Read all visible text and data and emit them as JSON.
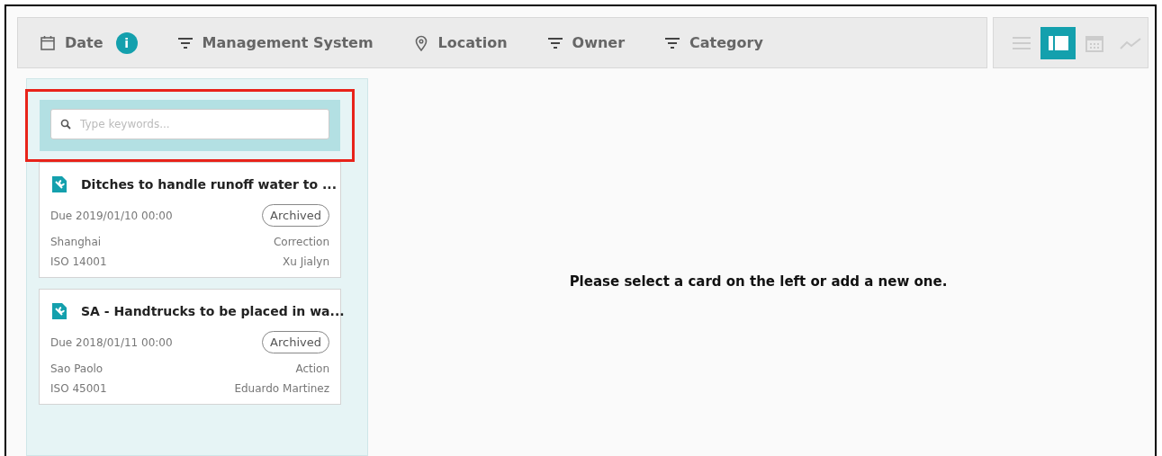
{
  "filters": [
    {
      "kind": "calendar",
      "label": "Date",
      "info": "i"
    },
    {
      "kind": "filter",
      "label": "Management System"
    },
    {
      "kind": "pin",
      "label": "Location"
    },
    {
      "kind": "filter",
      "label": "Owner"
    },
    {
      "kind": "filter",
      "label": "Category"
    }
  ],
  "views": [
    {
      "kind": "list",
      "selected": false
    },
    {
      "kind": "split",
      "selected": true
    },
    {
      "kind": "calendar",
      "selected": false
    },
    {
      "kind": "chart",
      "selected": false
    }
  ],
  "search": {
    "placeholder": "Type keywords...",
    "highlighted": true
  },
  "cards": [
    {
      "title": "Ditches to handle runoff water to ...",
      "due": "Due 2019/01/10 00:00",
      "status": "Archived",
      "location": "Shanghai",
      "type": "Correction",
      "system": "ISO 14001",
      "owner": "Xu Jialyn"
    },
    {
      "title": "SA - Handtrucks to be placed in wa...",
      "due": "Due 2018/01/11 00:00",
      "status": "Archived",
      "location": "Sao Paolo",
      "type": "Action",
      "system": "ISO 45001",
      "owner": "Eduardo Martinez"
    }
  ],
  "empty_message": "Please select a card on the left or add a new one."
}
